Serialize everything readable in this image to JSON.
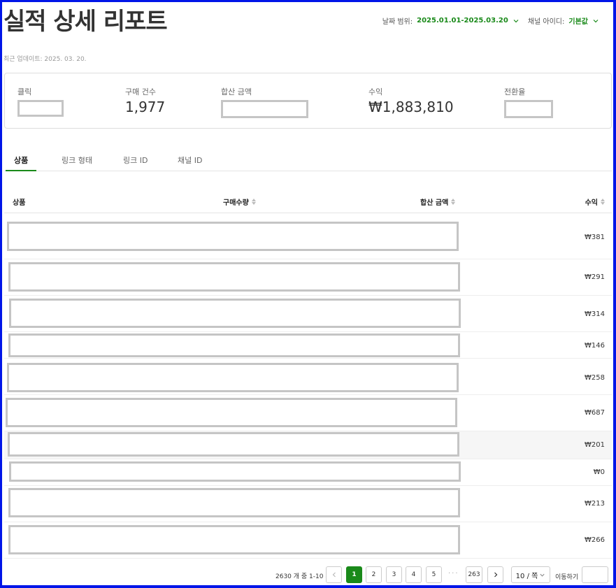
{
  "header": {
    "title": "실적 상세 리포트",
    "updated": "최근 업데이트: 2025. 03. 20.",
    "filters": {
      "date_label": "날짜 범위:",
      "date_value": "2025.01.01-2025.03.20",
      "channel_label": "채널 아이디:",
      "channel_value": "기본값"
    }
  },
  "summary": {
    "clicks_label": "클릭",
    "purchases_label": "구매 건수",
    "purchases_value": "1,977",
    "total_amount_label": "합산 금액",
    "revenue_label": "수익",
    "revenue_value": "₩1,883,810",
    "conversion_label": "전환율"
  },
  "tabs": [
    "상품",
    "링크 형태",
    "링크 ID",
    "채널 ID"
  ],
  "table": {
    "columns": [
      "상품",
      "구매수량",
      "합산 금액",
      "수익"
    ],
    "rows": [
      {
        "revenue": "₩381"
      },
      {
        "revenue": "₩291"
      },
      {
        "revenue": "₩314"
      },
      {
        "revenue": "₩146"
      },
      {
        "revenue": "₩258"
      },
      {
        "revenue": "₩687"
      },
      {
        "revenue": "₩201"
      },
      {
        "revenue": "₩0"
      },
      {
        "revenue": "₩213"
      },
      {
        "revenue": "₩266"
      }
    ]
  },
  "pagination": {
    "info": "2630 개 중 1-10 개",
    "pages": [
      "1",
      "2",
      "3",
      "4",
      "5"
    ],
    "ellipsis": "···",
    "last_page": "263",
    "per_page": "10 / 쪽",
    "goto_label": "이동하기",
    "goto_value": ""
  },
  "colors": {
    "accent": "#1a8a1a",
    "frame": "#0015e8",
    "redaction": "#c5c5c5"
  }
}
